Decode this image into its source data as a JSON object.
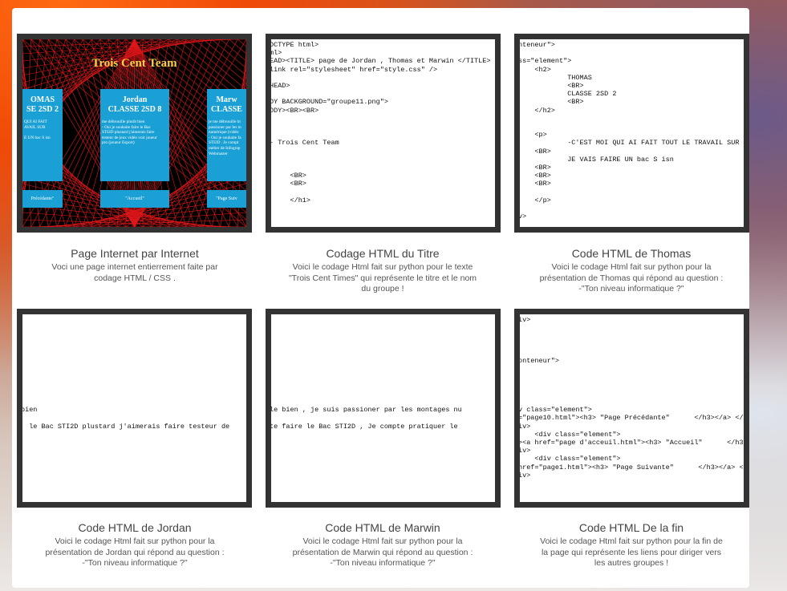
{
  "items": [
    {
      "title": "Page Internet par Internet",
      "desc": [
        "Voci une page internet entierrement faite par",
        "codage HTML / CSS ."
      ],
      "site": {
        "heading": "Trois Cent Team",
        "panels": [
          {
            "name": "OMAS\nSE 2SD 2",
            "text": "QUI AI FAIT\nAVAIL SUR\n\nE UN bac S isn"
          },
          {
            "name": "Jordan\nCLASSE 2SD 8",
            "text": "me débrouille plutôt bien\n- Oui je souhaite faire le Bac\nSTI2D plustard j'aimerais faire\ntesteur de jeux vidéo voir joueur\npro (joueur Esport)"
          },
          {
            "name": "Marw\nCLASSE",
            "text": "je me débrouille bi\npassioner par les m\nnumérique (vidéo\n- Oui je souhaite fa\nSTI2D . Je compt\nmétier de Infograp\nWebmaster"
          }
        ],
        "buttons": [
          "Précédante\"",
          "\"Accueil\"",
          "\"Page Suiv"
        ]
      }
    },
    {
      "title": "Codage HTML du Titre",
      "desc": [
        "Voici le codage Html fait sur python pour le texte",
        "\"Trois Cent Times\" qui représente le titre et le nom",
        "du groupe !"
      ],
      "code": "OCTYPE html>\nml>\nEAD><TITLE> page de Jordan , Thomas et Marwin </TITLE>\nlink rel=\"stylesheet\" href=\"style.css\" />\n\nHEAD>\n\nDY BACKGROUND=\"groupe11.png\">\nODY><BR><BR>\n\n\n\n- Trois Cent Team\n\n\n\n     <BR>\n     <BR>\n\n     </h1>"
    },
    {
      "title": "Code HTML de Thomas",
      "desc": [
        "Voici le codage Html fait sur python pour la",
        "présentation de Thomas qui répond au question :",
        "-\"Ton niveau informatique ?\""
      ],
      "code": "nteneur\">\n\nss=\"element\">\n    <h2>\n            THOMAS\n            <BR>\n            CLASSE 2SD 2\n            <BR>\n    </h2>\n\n\n    <p>\n            -C'EST MOI QUI AI FAIT TOUT LE TRAVAIL SUR SI\n    <BR>\n            JE VAIS FAIRE UN bac S isn\n    <BR>\n    <BR>\n    <BR>\n\n    </p>\n\nv>"
    },
    {
      "title": "Code HTML de Jordan",
      "desc": [
        "Voici le codage Html fait sur python pour la",
        "présentation de Jordan qui répond au question :",
        "-\"Ton niveau informatique ?\""
      ],
      "code": "\n\n\n\n\n\n\n\n\n\n\nbien\n\n  le Bac STI2D plustard j'aimerais faire testeur de"
    },
    {
      "title": "Code HTML de Marwin",
      "desc": [
        "Voici le codage Html fait sur python pour la",
        "présentation de Marwin qui répond au question :",
        "-\"Ton niveau informatique ?\""
      ],
      "code": "\n\n\n\n\n\n\n\n\n\n\nle bien , je suis passioner par les montages nu\n\nte faire le Bac STI2D , Je compte pratiquer le"
    },
    {
      "title": "Code HTML De la fin",
      "desc": [
        "Voici le codage Html fait sur python pour la fin de",
        "la page qui représente les liens pour diriger vers",
        "les autres groupes !"
      ],
      "code": "iv>\n\n\n\n\nonteneur\">\n\n\n\n\n\nv class=\"element\">\n=\"page10.html\"><h3> \"Page Précédante\"      </h3></a> </\niv>\n    <div class=\"element\">\n><a href=\"page d'acceuil.html\"><h3> \"Accueil\"      </h3\niv>\n    <div class=\"element\">\nhref=\"page1.html\"><h3> \"Page Suivante\"      </h3></a> <\niv>"
    }
  ]
}
